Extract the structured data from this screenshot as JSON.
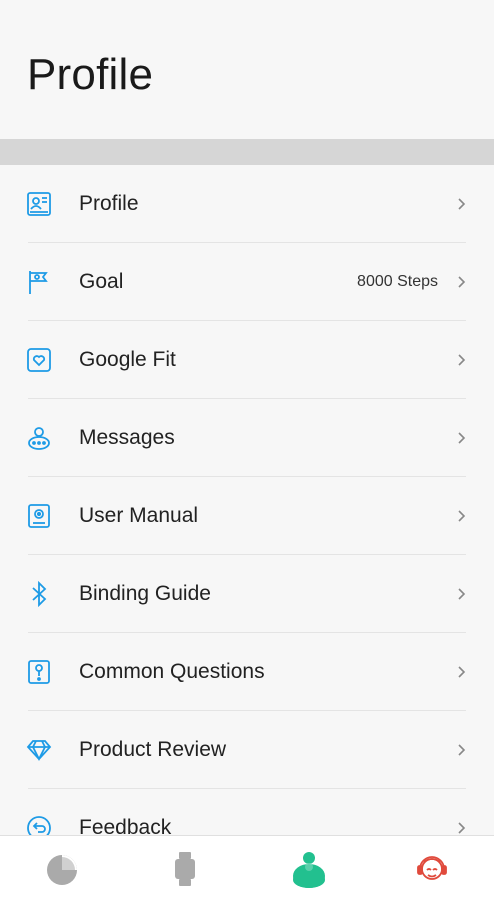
{
  "header": {
    "title": "Profile"
  },
  "colors": {
    "accent_blue": "#1e9be6",
    "nav_active": "#22c08f",
    "nav_inactive": "#aaaaaa",
    "support_red": "#e04a3c"
  },
  "menu": {
    "items": [
      {
        "label": "Profile",
        "value": "",
        "icon": "profile-card-icon"
      },
      {
        "label": "Goal",
        "value": "8000 Steps",
        "icon": "flag-icon"
      },
      {
        "label": "Google Fit",
        "value": "",
        "icon": "google-fit-icon"
      },
      {
        "label": "Messages",
        "value": "",
        "icon": "messages-icon"
      },
      {
        "label": "User Manual",
        "value": "",
        "icon": "user-manual-icon"
      },
      {
        "label": "Binding Guide",
        "value": "",
        "icon": "bluetooth-icon"
      },
      {
        "label": "Common Questions",
        "value": "",
        "icon": "questions-icon"
      },
      {
        "label": "Product Review",
        "value": "",
        "icon": "diamond-icon"
      },
      {
        "label": "Feedback",
        "value": "",
        "icon": "feedback-icon"
      }
    ]
  },
  "bottom_nav": {
    "tabs": [
      {
        "icon": "pie-chart-icon",
        "active": false
      },
      {
        "icon": "watch-icon",
        "active": false
      },
      {
        "icon": "person-icon",
        "active": true
      },
      {
        "icon": "customer-support-icon",
        "active": false
      }
    ]
  }
}
